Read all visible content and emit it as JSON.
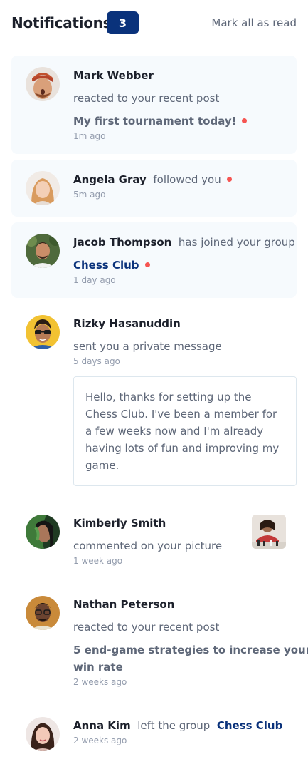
{
  "header": {
    "title": "Notifications",
    "unread_count": "3",
    "mark_all_label": "Mark all as read"
  },
  "notifications": [
    {
      "name": "Mark Webber",
      "action": "reacted to your recent post",
      "post": "My first tournament today!",
      "time": "1m ago",
      "unread": true
    },
    {
      "name": "Angela Gray",
      "action": "followed you",
      "time": "5m ago",
      "unread": true
    },
    {
      "name": "Jacob Thompson",
      "action": "has joined your group",
      "group": "Chess Club",
      "time": "1 day ago",
      "unread": true
    },
    {
      "name": "Rizky Hasanuddin",
      "action": "sent you a private message",
      "time": "5 days ago",
      "message_lines": [
        "Hello, thanks for setting up the",
        "Chess Club. I've been a member for",
        "a few weeks now and I'm already",
        "having lots of fun and improving my",
        "game."
      ],
      "unread": false
    },
    {
      "name": "Kimberly Smith",
      "action": "commented on your picture",
      "time": "1 week ago",
      "unread": false
    },
    {
      "name": "Nathan Peterson",
      "action": "reacted to your recent post",
      "post_lines": [
        "5 end-game strategies to increase your",
        "win rate"
      ],
      "time": "2 weeks ago",
      "unread": false
    },
    {
      "name": "Anna Kim",
      "action": "left the group",
      "group": "Chess Club",
      "time": "2 weeks ago",
      "unread": false
    }
  ],
  "colors": {
    "navy": "#0a327b",
    "unread_bg": "#f6fafd",
    "red_dot": "#f65552",
    "text_dark": "#1c202b",
    "text_grey": "#5e6778",
    "text_light": "#939cad"
  }
}
